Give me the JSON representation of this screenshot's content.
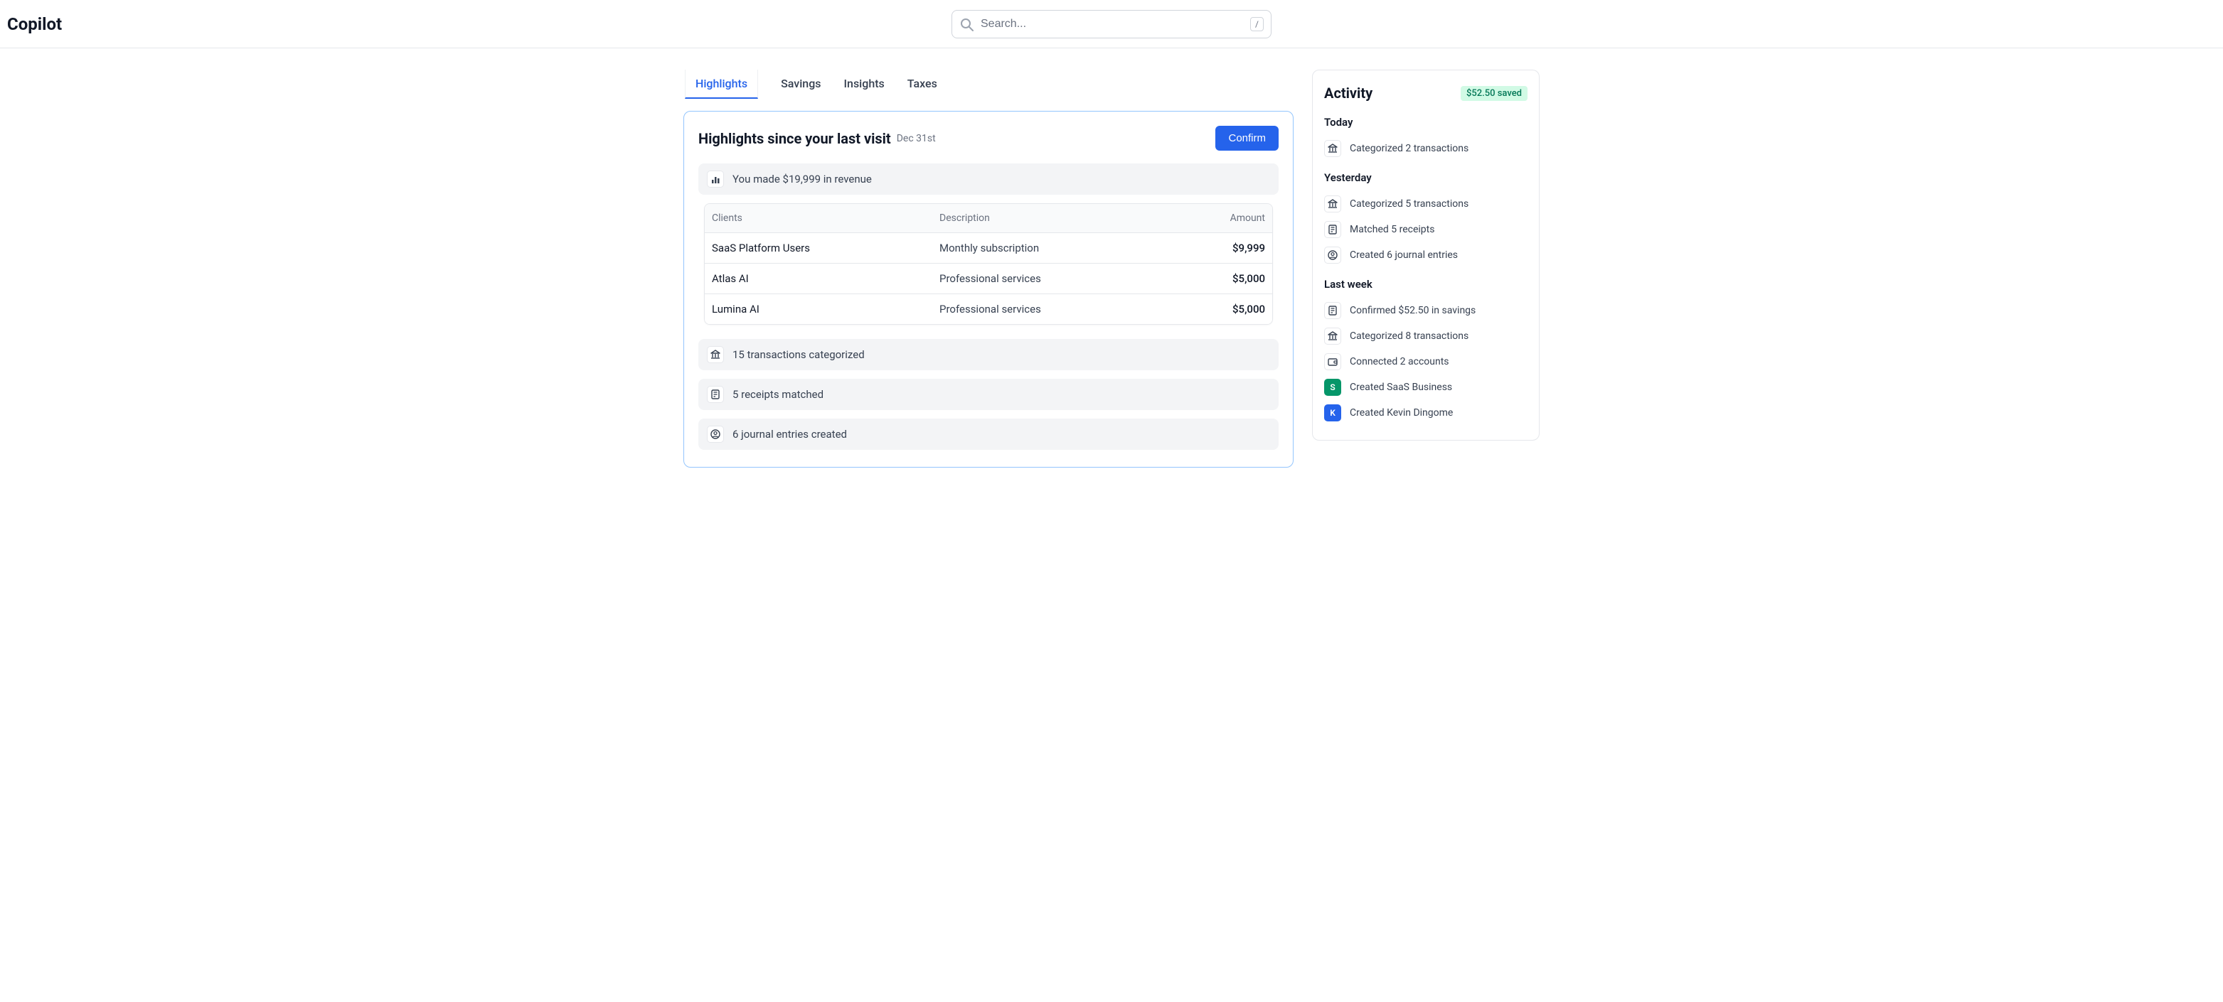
{
  "header": {
    "brand": "Copilot",
    "search_placeholder": "Search...",
    "search_shortcut": "/"
  },
  "tabs": [
    {
      "label": "Highlights",
      "active": true
    },
    {
      "label": "Savings",
      "active": false
    },
    {
      "label": "Insights",
      "active": false
    },
    {
      "label": "Taxes",
      "active": false
    }
  ],
  "highlights": {
    "title": "Highlights since your last visit",
    "date": "Dec 31st",
    "confirm_label": "Confirm",
    "revenue_line": "You made $19,999 in revenue",
    "table": {
      "headers": {
        "clients": "Clients",
        "description": "Description",
        "amount": "Amount"
      },
      "rows": [
        {
          "client": "SaaS Platform Users",
          "description": "Monthly subscription",
          "amount": "$9,999"
        },
        {
          "client": "Atlas AI",
          "description": "Professional services",
          "amount": "$5,000"
        },
        {
          "client": "Lumina AI",
          "description": "Professional services",
          "amount": "$5,000"
        }
      ]
    },
    "summary_rows": [
      {
        "icon": "bank",
        "text": "15 transactions categorized"
      },
      {
        "icon": "receipt",
        "text": "5 receipts matched"
      },
      {
        "icon": "user-circle",
        "text": "6 journal entries created"
      }
    ]
  },
  "activity": {
    "title": "Activity",
    "saved_badge": "$52.50 saved",
    "sections": [
      {
        "label": "Today",
        "items": [
          {
            "icon": "bank",
            "text": "Categorized 2 transactions"
          }
        ]
      },
      {
        "label": "Yesterday",
        "items": [
          {
            "icon": "bank",
            "text": "Categorized 5 transactions"
          },
          {
            "icon": "receipt",
            "text": "Matched 5 receipts"
          },
          {
            "icon": "user-circle",
            "text": "Created 6 journal entries"
          }
        ]
      },
      {
        "label": "Last week",
        "items": [
          {
            "icon": "receipt",
            "text": "Confirmed $52.50 in savings"
          },
          {
            "icon": "bank",
            "text": "Categorized 8 transactions"
          },
          {
            "icon": "wallet",
            "text": "Connected 2 accounts"
          },
          {
            "icon": "avatar",
            "avatar_letter": "S",
            "avatar_color": "green",
            "text": "Created SaaS Business"
          },
          {
            "icon": "avatar",
            "avatar_letter": "K",
            "avatar_color": "blue",
            "text": "Created Kevin Dingome"
          }
        ]
      }
    ]
  }
}
